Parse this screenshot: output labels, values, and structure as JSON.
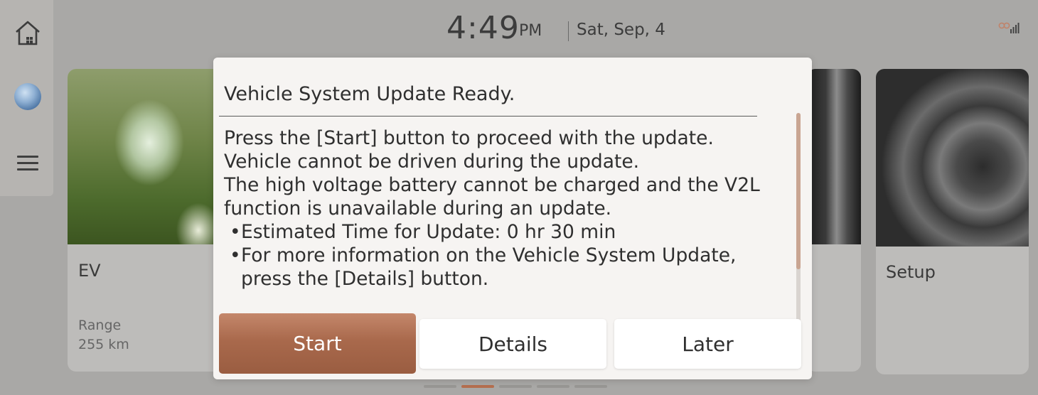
{
  "sidebar": {
    "icons": [
      "home-icon",
      "globe-icon",
      "menu-icon"
    ]
  },
  "status_bar": {
    "time": "4:49",
    "ampm": "PM",
    "date": "Sat, Sep, 4",
    "signal_icon": "signal-icon"
  },
  "cards": {
    "ev": {
      "title": "EV",
      "range_label": "Range",
      "range_value": "255 km"
    },
    "setup": {
      "title": "Setup"
    }
  },
  "pagination": {
    "count": 5,
    "active_index": 1
  },
  "modal": {
    "title": "Vehicle System Update Ready.",
    "body_lines": [
      "Press the [Start] button to proceed with the update.",
      "Vehicle cannot be driven during the update.",
      "The high voltage battery cannot be charged and the V2L function is unavailable during an update."
    ],
    "bullets": [
      "Estimated Time for Update: 0 hr 30 min",
      "For more information on the Vehicle System Update, press the [Details] button."
    ],
    "buttons": {
      "start": "Start",
      "details": "Details",
      "later": "Later"
    }
  },
  "colors": {
    "accent": "#b56f4f",
    "modal_bg": "#f6f4f2",
    "start_button": "#a9694c"
  }
}
